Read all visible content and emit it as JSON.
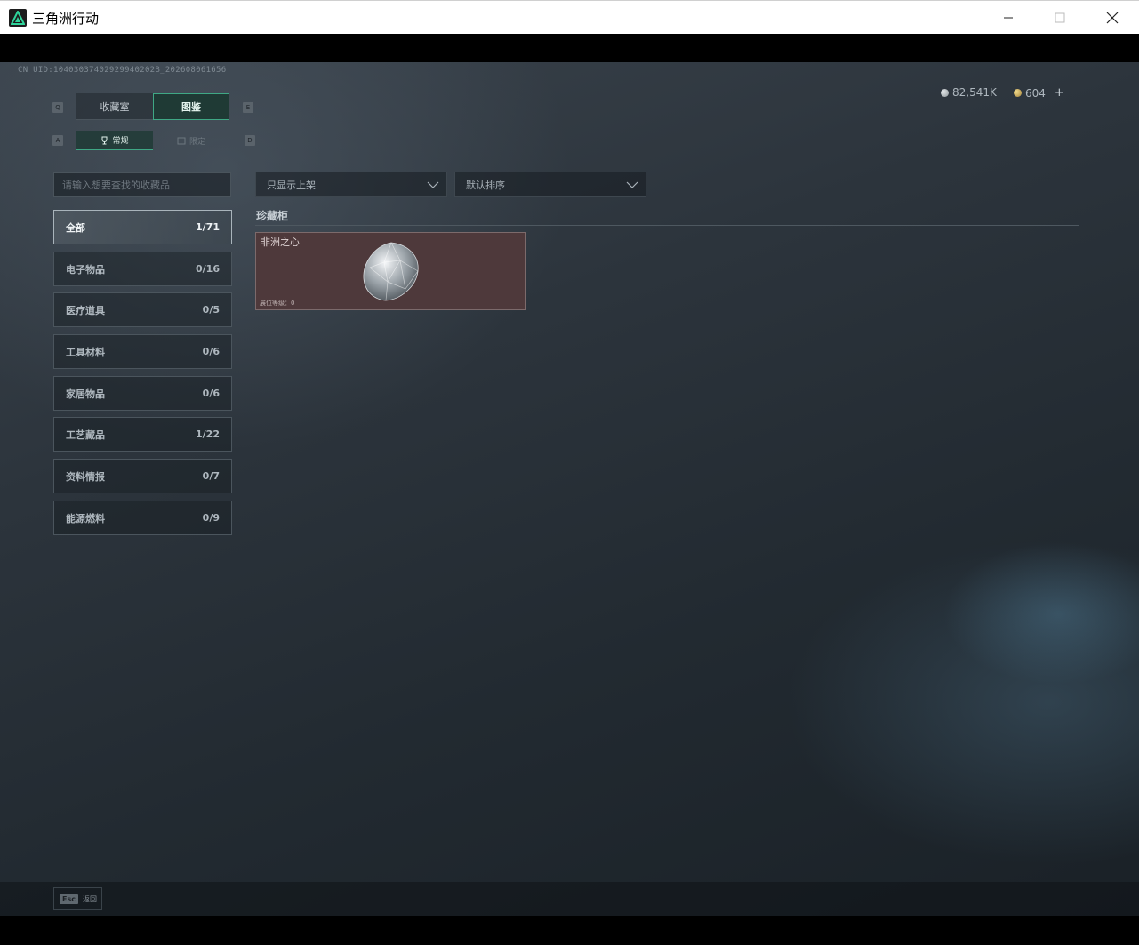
{
  "window": {
    "title": "三角洲行动",
    "minimize_icon": "minimize-icon",
    "maximize_icon": "maximize-icon",
    "close_icon": "close-icon"
  },
  "header": {
    "uid": "CN UID:10403037402929940202B_202608061656",
    "currency_silver": "82,541K",
    "currency_gold": "604",
    "add_label": "+"
  },
  "tabs": {
    "left_key": "Q",
    "right_key": "E",
    "collection": "收藏室",
    "atlas": "图鉴"
  },
  "subtabs": {
    "left_key": "A",
    "right_key": "D",
    "normal": "常规",
    "limited": "限定"
  },
  "search": {
    "placeholder": "请输入想要查找的收藏品"
  },
  "filters": {
    "shelf_filter": "只显示上架",
    "sort": "默认排序"
  },
  "categories": [
    {
      "label": "全部",
      "count": "1/71",
      "active": true
    },
    {
      "label": "电子物品",
      "count": "0/16"
    },
    {
      "label": "医疗道具",
      "count": "0/5"
    },
    {
      "label": "工具材料",
      "count": "0/6"
    },
    {
      "label": "家居物品",
      "count": "0/6"
    },
    {
      "label": "工艺藏品",
      "count": "1/22"
    },
    {
      "label": "资料情报",
      "count": "0/7"
    },
    {
      "label": "能源燃料",
      "count": "0/9"
    }
  ],
  "section": {
    "title": "珍藏柜",
    "items": [
      {
        "name": "非洲之心",
        "level": "展位等级：0",
        "icon": "diamond-icon"
      }
    ]
  },
  "footer": {
    "esc_key": "Esc",
    "esc_label": "返回"
  },
  "colors": {
    "accent": "#3fa885",
    "item_bg": "#4e393b",
    "background": "#2c343c"
  }
}
